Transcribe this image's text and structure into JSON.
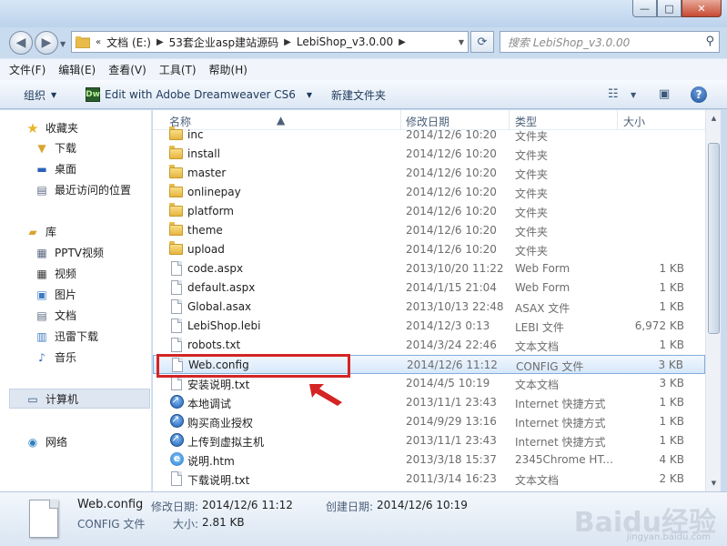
{
  "window": {
    "controls": {
      "minimize": "—",
      "maximize": "□",
      "close": "✕"
    }
  },
  "address": {
    "overflow": "«",
    "segments": [
      "文档 (E:)",
      "53套企业asp建站源码",
      "LebiShop_v3.0.00"
    ],
    "search_placeholder": "搜索 LebiShop_v3.0.00"
  },
  "menu": [
    "文件(F)",
    "编辑(E)",
    "查看(V)",
    "工具(T)",
    "帮助(H)"
  ],
  "toolbar": {
    "organize": "组织",
    "open_with": "Edit with Adobe Dreamweaver CS6",
    "dw_badge": "Dw",
    "new_folder": "新建文件夹",
    "help": "?"
  },
  "nav": {
    "favorites": {
      "label": "收藏夹",
      "items": [
        "下载",
        "桌面",
        "最近访问的位置"
      ]
    },
    "libraries": {
      "label": "库",
      "items": [
        "PPTV视频",
        "视频",
        "图片",
        "文档",
        "迅雷下载",
        "音乐"
      ]
    },
    "computer": "计算机",
    "network": "网络"
  },
  "columns": {
    "name": "名称",
    "date": "修改日期",
    "type": "类型",
    "size": "大小"
  },
  "files": [
    {
      "name": "inc",
      "date": "2014/12/6 10:20",
      "type": "文件夹",
      "size": "",
      "icon": "folder"
    },
    {
      "name": "install",
      "date": "2014/12/6 10:20",
      "type": "文件夹",
      "size": "",
      "icon": "folder"
    },
    {
      "name": "master",
      "date": "2014/12/6 10:20",
      "type": "文件夹",
      "size": "",
      "icon": "folder"
    },
    {
      "name": "onlinepay",
      "date": "2014/12/6 10:20",
      "type": "文件夹",
      "size": "",
      "icon": "folder"
    },
    {
      "name": "platform",
      "date": "2014/12/6 10:20",
      "type": "文件夹",
      "size": "",
      "icon": "folder"
    },
    {
      "name": "theme",
      "date": "2014/12/6 10:20",
      "type": "文件夹",
      "size": "",
      "icon": "folder"
    },
    {
      "name": "upload",
      "date": "2014/12/6 10:20",
      "type": "文件夹",
      "size": "",
      "icon": "folder"
    },
    {
      "name": "code.aspx",
      "date": "2013/10/20 11:22",
      "type": "Web Form",
      "size": "1 KB",
      "icon": "doc"
    },
    {
      "name": "default.aspx",
      "date": "2014/1/15 21:04",
      "type": "Web Form",
      "size": "1 KB",
      "icon": "doc"
    },
    {
      "name": "Global.asax",
      "date": "2013/10/13 22:48",
      "type": "ASAX 文件",
      "size": "1 KB",
      "icon": "doc"
    },
    {
      "name": "LebiShop.lebi",
      "date": "2014/12/3 0:13",
      "type": "LEBI 文件",
      "size": "6,972 KB",
      "icon": "doc"
    },
    {
      "name": "robots.txt",
      "date": "2014/3/24 22:46",
      "type": "文本文档",
      "size": "1 KB",
      "icon": "doc"
    },
    {
      "name": "Web.config",
      "date": "2014/12/6 11:12",
      "type": "CONFIG 文件",
      "size": "3 KB",
      "icon": "doc",
      "selected": true
    },
    {
      "name": "安装说明.txt",
      "date": "2014/4/5 10:19",
      "type": "文本文档",
      "size": "3 KB",
      "icon": "doc"
    },
    {
      "name": "本地调试",
      "date": "2013/11/1 23:43",
      "type": "Internet 快捷方式",
      "size": "1 KB",
      "icon": "link"
    },
    {
      "name": "购买商业授权",
      "date": "2014/9/29 13:16",
      "type": "Internet 快捷方式",
      "size": "1 KB",
      "icon": "link"
    },
    {
      "name": "上传到虚拟主机",
      "date": "2013/11/1 23:43",
      "type": "Internet 快捷方式",
      "size": "1 KB",
      "icon": "link"
    },
    {
      "name": "说明.htm",
      "date": "2013/3/18 15:37",
      "type": "2345Chrome HT...",
      "size": "4 KB",
      "icon": "ie"
    },
    {
      "name": "下载说明.txt",
      "date": "2011/3/14 16:23",
      "type": "文本文档",
      "size": "2 KB",
      "icon": "doc"
    }
  ],
  "details": {
    "name": "Web.config",
    "type": "CONFIG 文件",
    "modified_label": "修改日期:",
    "modified": "2014/12/6 11:12",
    "created_label": "创建日期:",
    "created": "2014/12/6 10:19",
    "size_label": "大小:",
    "size": "2.81 KB"
  },
  "watermark": {
    "brand": "Baidu经验",
    "url": "jingyan.baidu.com"
  },
  "colors": {
    "annotation": "#d42424",
    "selection": "#d6e8fb"
  }
}
